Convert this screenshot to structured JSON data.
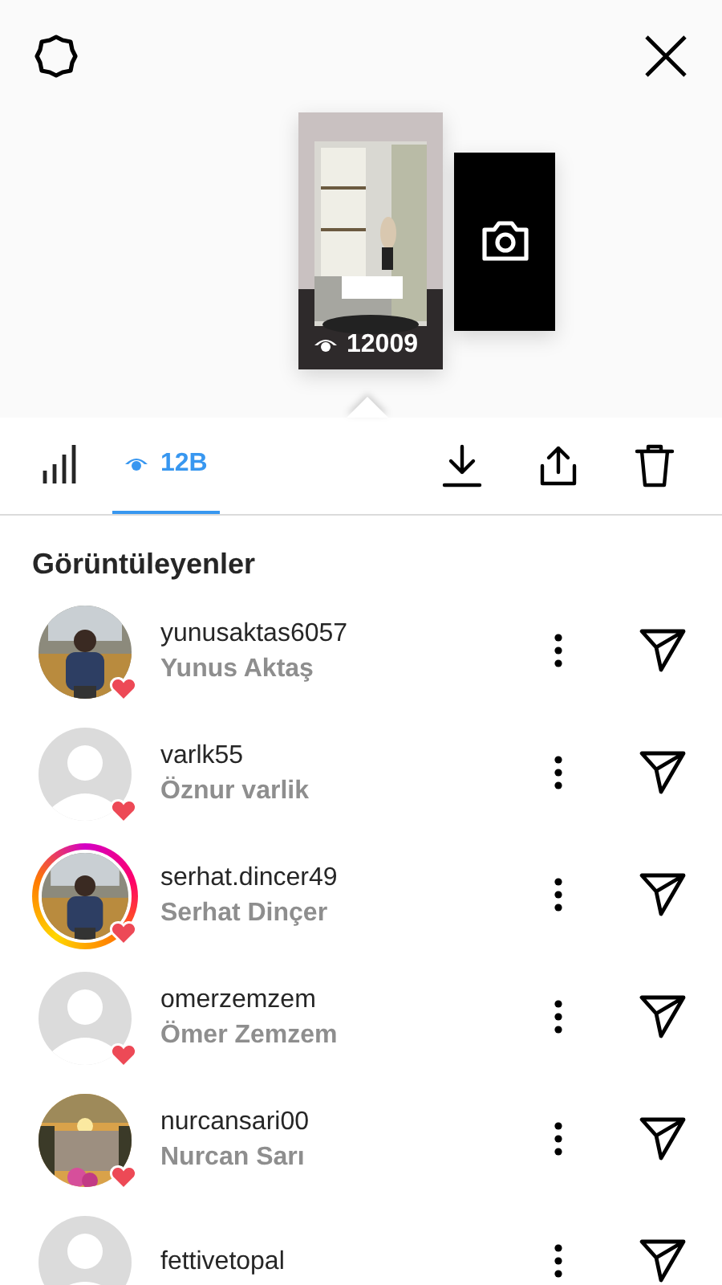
{
  "story_preview": {
    "views": "12009"
  },
  "tabs": [
    {
      "kind": "insights",
      "selected": false
    },
    {
      "kind": "viewers",
      "label": "12B",
      "selected": true
    }
  ],
  "actions": [
    {
      "kind": "download"
    },
    {
      "kind": "share"
    },
    {
      "kind": "delete"
    }
  ],
  "section_title": "Görüntüleyenler",
  "viewers": [
    {
      "username": "yunusaktas6057",
      "full_name": "Yunus Aktaş",
      "story_ring": false,
      "liked": true
    },
    {
      "username": "varlk55",
      "full_name": "Öznur varlik",
      "kind": "default",
      "story_ring": false,
      "liked": true
    },
    {
      "username": "serhat.dincer49",
      "full_name": "Serhat Dinçer",
      "story_ring": true,
      "liked": true
    },
    {
      "username": "omerzemzem",
      "full_name": "Ömer Zemzem",
      "kind": "default",
      "story_ring": false,
      "liked": true
    },
    {
      "username": "nurcansari00",
      "full_name": "Nurcan Sarı",
      "kind": "sunset",
      "story_ring": false,
      "liked": true
    },
    {
      "username": "fettivetopal",
      "kind": "default"
    }
  ]
}
